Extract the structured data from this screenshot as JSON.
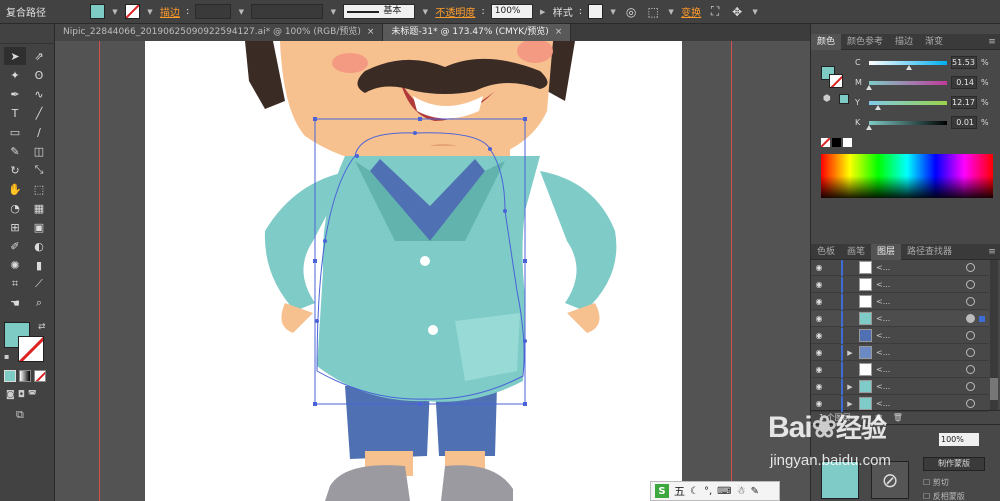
{
  "control_bar": {
    "object_type": "复合路径",
    "stroke_label": "描边",
    "stroke_style": "基本",
    "opacity_label": "不透明度",
    "opacity_value": "100%",
    "style_label": "样式",
    "transform_label": "变换"
  },
  "tabs": [
    {
      "label": "Nipic_22844066_20190625090922594127.ai* @ 100% (RGB/预览)",
      "close": "×",
      "active": false
    },
    {
      "label": "未标题-31* @ 173.47% (CMYK/预览)",
      "close": "×",
      "active": true
    }
  ],
  "colors": {
    "fill": "#7ecbc5",
    "shirt": "#7ecbc8",
    "shirt_dark": "#62b3ad",
    "pants": "#4f71b3",
    "skin": "#f7c08f",
    "mustache": "#3b2b25",
    "selection": "#4a63d6",
    "accent_orange": "#ff9c2a"
  },
  "color_panel": {
    "tabs": [
      "颜色",
      "颜色参考",
      "描边",
      "渐变"
    ],
    "channels": [
      {
        "label": "C",
        "value": "51.53",
        "fraction": 0.5153
      },
      {
        "label": "M",
        "value": "0.14",
        "fraction": 0.0014
      },
      {
        "label": "Y",
        "value": "12.17",
        "fraction": 0.1217
      },
      {
        "label": "K",
        "value": "0.01",
        "fraction": 0.0001
      }
    ],
    "pct_symbol": "%"
  },
  "layers_panel": {
    "tabs": [
      "色板",
      "画笔",
      "图层",
      "路径查找器"
    ],
    "rows": [
      {
        "name": "<...",
        "expand": false
      },
      {
        "name": "<...",
        "expand": false
      },
      {
        "name": "<...",
        "expand": false
      },
      {
        "name": "<...",
        "expand": false,
        "selected": true
      },
      {
        "name": "<...",
        "expand": false
      },
      {
        "name": "<...",
        "expand": true
      },
      {
        "name": "<...",
        "expand": false
      },
      {
        "name": "<...",
        "expand": true
      },
      {
        "name": "<...",
        "expand": true
      }
    ],
    "footer": "1 个图层"
  },
  "transparency_panel": {
    "opacity_value": "100%",
    "mask_button": "制作蒙版",
    "clip_label": "剪切",
    "invert_label": "反相蒙版"
  },
  "ime_bar": {
    "logo": "S",
    "mode": "五"
  },
  "watermark": {
    "brand": "Bai",
    "brand_cn": "经验",
    "url": "jingyan.baidu.com"
  }
}
